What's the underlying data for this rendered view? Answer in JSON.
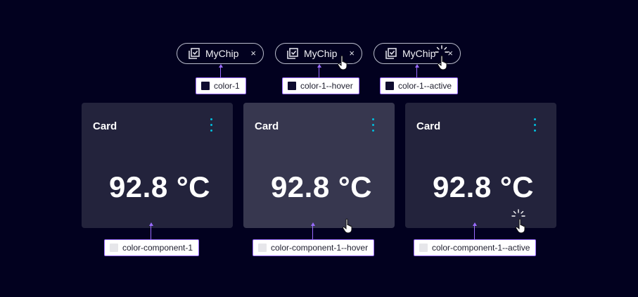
{
  "chips": [
    {
      "label": "MyChip",
      "close": "×",
      "token": "color-1",
      "swatch": "#0e0c2e"
    },
    {
      "label": "MyChip",
      "close": "×",
      "token": "color-1--hover",
      "swatch": "#0e0c2e"
    },
    {
      "label": "MyChip",
      "close": "×",
      "token": "color-1--active",
      "swatch": "#0e0c2e"
    }
  ],
  "cards": [
    {
      "title": "Card",
      "value": "92.8 °C",
      "token": "color-component-1",
      "background": "#23233c",
      "swatch": "#e6e6ea"
    },
    {
      "title": "Card",
      "value": "92.8 °C",
      "token": "color-component-1--hover",
      "background": "#37374f",
      "swatch": "#e6e6ea"
    },
    {
      "title": "Card",
      "value": "92.8 °C",
      "token": "color-component-1--active",
      "background": "#23233c",
      "swatch": "#e6e6ea"
    }
  ],
  "colors": {
    "page_background": "#02011f",
    "annotation_line": "#9a6cff",
    "chip_border": "#b9bccb",
    "menu_dots": "#00bedc"
  },
  "icons": {
    "chip": "checkbox-stack-icon",
    "chip_close": "close-icon",
    "card_menu": "kebab-menu-icon",
    "pointer": "hand-pointer-icon",
    "click": "click-burst-icon"
  }
}
